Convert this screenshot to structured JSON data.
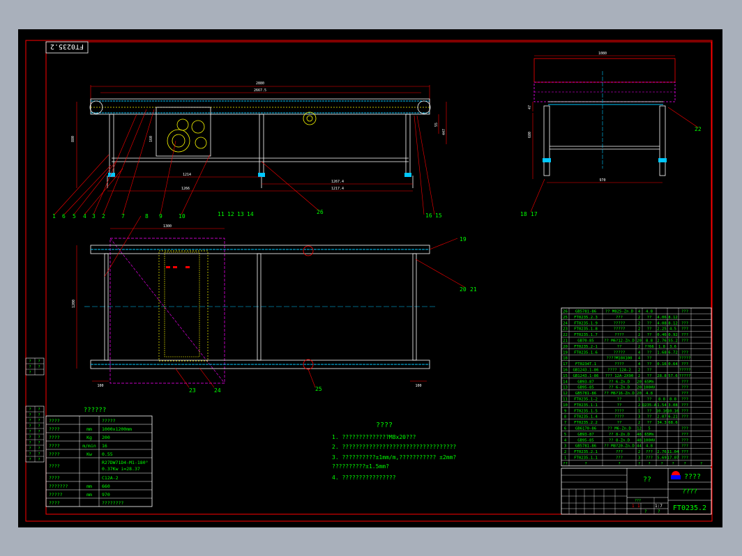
{
  "drawing_no": "FT0235.2",
  "drawing_no_mirrored": "FT0235.2",
  "colors": {
    "background": "#000000",
    "frame": "#ff0000",
    "text": "#00ff00",
    "geometry": "#ffffff",
    "parts": "#ffff00",
    "dims": "#ff0000",
    "hidden": "#ff00ff",
    "cyan": "#00c8ff"
  },
  "front_view": {
    "dims": {
      "overall_len": "2880",
      "pulley_len": "2667.5",
      "height": "880",
      "d_right1": "55",
      "d_right2": "447",
      "d_left": "160",
      "span_a": "1214",
      "span_b": "1266",
      "span_c": "1267.4",
      "span_d": "1217.4"
    },
    "callouts_bottom": [
      "1",
      "6",
      "5",
      "4",
      "3",
      "2",
      "7",
      "8",
      "9",
      "10",
      "11",
      "12",
      "13",
      "14",
      "26",
      "16",
      "15"
    ]
  },
  "side_view": {
    "dims": {
      "top_width": "1080",
      "width": "970",
      "h1": "47",
      "h2": "680"
    },
    "callouts": [
      "22",
      "18",
      "17"
    ]
  },
  "top_view": {
    "dims": {
      "top_len": "1300",
      "width": "1200",
      "foot_l": "100",
      "foot_r": "100"
    },
    "callouts": [
      "19",
      "20",
      "21",
      "23",
      "24",
      "25"
    ]
  },
  "parts_list": [
    {
      "no": "26",
      "code": "GB5781-86",
      "name": "?? M825-Zn.D",
      "qty": "4",
      "mat": "4.8",
      "w1": "",
      "w2": "",
      "note": "???"
    },
    {
      "no": "25",
      "code": "FT0235.2.3",
      "name": "???",
      "qty": "2",
      "mat": "??",
      "w1": "4.06",
      "w2": "8.12",
      "note": ""
    },
    {
      "no": "24",
      "code": "FT0235.1.9",
      "name": "?????",
      "qty": "2",
      "mat": "??",
      "w1": "4.08",
      "w2": "8.12",
      "note": "???"
    },
    {
      "no": "23",
      "code": "FT0235.1.8",
      "name": "?????",
      "qty": "2",
      "mat": "??",
      "w1": "2.25",
      "w2": "4.5",
      "note": "???"
    },
    {
      "no": "22",
      "code": "FT0235.1.7",
      "name": "????",
      "qty": "2",
      "mat": "??",
      "w1": "0.46",
      "w2": "0.92",
      "note": "???"
    },
    {
      "no": "21",
      "code": "GB70-85",
      "name": "?? M6?12-Zn.D",
      "qty": "20",
      "mat": "8.8",
      "w1": "2.76",
      "w2": "55.2",
      "note": "???"
    },
    {
      "no": "20",
      "code": "FT0235.2-1",
      "name": "??",
      "qty": "2",
      "mat": "??66",
      "w1": "1.8",
      "w2": "3.6",
      "note": ""
    },
    {
      "no": "19",
      "code": "FT0235.1.6",
      "name": "?????",
      "qty": "4",
      "mat": "??",
      "w1": "1.68",
      "w2": "6.72",
      "note": "???"
    },
    {
      "no": "18",
      "code": "",
      "name": "????M10X100",
      "qty": "4",
      "mat": "??",
      "w1": "",
      "w2": "",
      "note": "?????"
    },
    {
      "no": "17",
      "code": "FT0234T.1",
      "name": "????",
      "qty": "4",
      "mat": "??",
      "w1": "0.16",
      "w2": "0.64",
      "note": "???"
    },
    {
      "no": "16",
      "code": "GB1243.1-86",
      "name": "???? 12A-2",
      "qty": "2",
      "mat": "??",
      "w1": "",
      "w2": "",
      "note": "?????"
    },
    {
      "no": "15",
      "code": "GB1243.1-86",
      "name": "??? 12A-2X90",
      "qty": "2",
      "mat": "??",
      "w1": "28.8",
      "w2": "57.6",
      "note": "?????"
    },
    {
      "no": "14",
      "code": "GB93-87",
      "name": "?? 6-Zn.D",
      "qty": "20",
      "mat": "65Mn",
      "w1": "",
      "w2": "",
      "note": "???"
    },
    {
      "no": "13",
      "code": "GB95-85",
      "name": "?? 6-Zn.D",
      "qty": "20",
      "mat": "100HV",
      "w1": "",
      "w2": "",
      "note": "???"
    },
    {
      "no": "12",
      "code": "GB5781-86",
      "name": "?? M6?16-Zn.D",
      "qty": "20",
      "mat": "4.8",
      "w1": "",
      "w2": "",
      "note": "???"
    },
    {
      "no": "11",
      "code": "FT0235.1-2",
      "name": "??",
      "qty": "1",
      "mat": "??",
      "w1": "8.8",
      "w2": "8.8",
      "note": "???"
    },
    {
      "no": "10",
      "code": "FT0235.1-1",
      "name": "??",
      "qty": "2",
      "mat": "Q235-A",
      "w1": "1.54",
      "w2": "3.08",
      "note": "???"
    },
    {
      "no": "9",
      "code": "FT0235.1.5",
      "name": "????",
      "qty": "1",
      "mat": "??",
      "w1": "10.16",
      "w2": "10.16",
      "note": "???"
    },
    {
      "no": "8",
      "code": "FT0235.1.4",
      "name": "????",
      "qty": "3",
      "mat": "??",
      "w1": "2.07",
      "w2": "6.21",
      "note": "???"
    },
    {
      "no": "7",
      "code": "FT0235.2.2",
      "name": "??",
      "qty": "2",
      "mat": "??",
      "w1": "34.3",
      "w2": "68.6",
      "note": ""
    },
    {
      "no": "6",
      "code": "GB6170-86",
      "name": "?? M6-Zn.D",
      "qty": "12",
      "mat": "5",
      "w1": "",
      "w2": "",
      "note": "???"
    },
    {
      "no": "5",
      "code": "GB93-87",
      "name": "?? 8-Zn.D",
      "qty": "48",
      "mat": "65Mn",
      "w1": "",
      "w2": "",
      "note": "???"
    },
    {
      "no": "4",
      "code": "GB95-85",
      "name": "?? 8-Zn.D",
      "qty": "48",
      "mat": "100HV",
      "w1": "",
      "w2": "",
      "note": "???"
    },
    {
      "no": "3",
      "code": "GB5781-86",
      "name": "?? M8?20-Zn.D",
      "qty": "44",
      "mat": "4.8",
      "w1": "",
      "w2": "",
      "note": "???"
    },
    {
      "no": "2",
      "code": "FT0235.2.1",
      "name": "???",
      "qty": "2",
      "mat": "???",
      "w1": "2.76",
      "w2": "11.04",
      "note": "???"
    },
    {
      "no": "1",
      "code": "FT0235.1.1",
      "name": "???",
      "qty": "3",
      "mat": "???",
      "w1": "5.69",
      "w2": "17.07",
      "note": "???"
    }
  ],
  "parts_header": [
    "??",
    "?",
    "?",
    "?",
    "?",
    "?",
    "?",
    "?",
    "?"
  ],
  "title_block": {
    "name_cell": "??",
    "company": "????",
    "drawn": "????",
    "scale1": "1",
    "scale2": "1",
    "ratio": "1:7",
    "sheet_label": "?",
    "sheet_of": "?",
    "count": "???"
  },
  "params": {
    "title": "??????",
    "rows": [
      {
        "name": "????",
        "unit": "",
        "value": "?????"
      },
      {
        "name": "????",
        "unit": "mm",
        "value": "1000x1200mm"
      },
      {
        "name": "????",
        "unit": "Kg",
        "value": "200"
      },
      {
        "name": "????",
        "unit": "m/min",
        "value": "16"
      },
      {
        "name": "????",
        "unit": "Kw",
        "value": "0.55"
      },
      {
        "name": "????",
        "unit": "",
        "value": "R27DW71D4-M1-180°",
        "value2": "0.37Kw  i=28.37"
      },
      {
        "name": "????",
        "unit": "",
        "value": "C12A-2"
      },
      {
        "name": "???????",
        "unit": "mm",
        "value": "660"
      },
      {
        "name": "?????",
        "unit": "mm",
        "value": "970"
      },
      {
        "name": "????",
        "unit": "",
        "value": "????????"
      }
    ]
  },
  "tech_notes": {
    "title": "????",
    "items": [
      "1. ??????????????M8x20???",
      "2. ??????????????????????????????????",
      "3. ??????????±1mm/m,???????????  ±2mm?",
      "   ??????????±1.5mm?",
      "4. ????????????????"
    ]
  },
  "left_margin": {
    "block1": [
      "?",
      "?",
      "?",
      "?",
      "?"
    ],
    "block2": [
      "?",
      "?",
      "?",
      "?",
      "?",
      "?",
      "?",
      "?",
      "?",
      "?",
      "?",
      "?",
      "?",
      "?",
      "?",
      "?",
      "?",
      "?",
      "?",
      "?"
    ]
  }
}
